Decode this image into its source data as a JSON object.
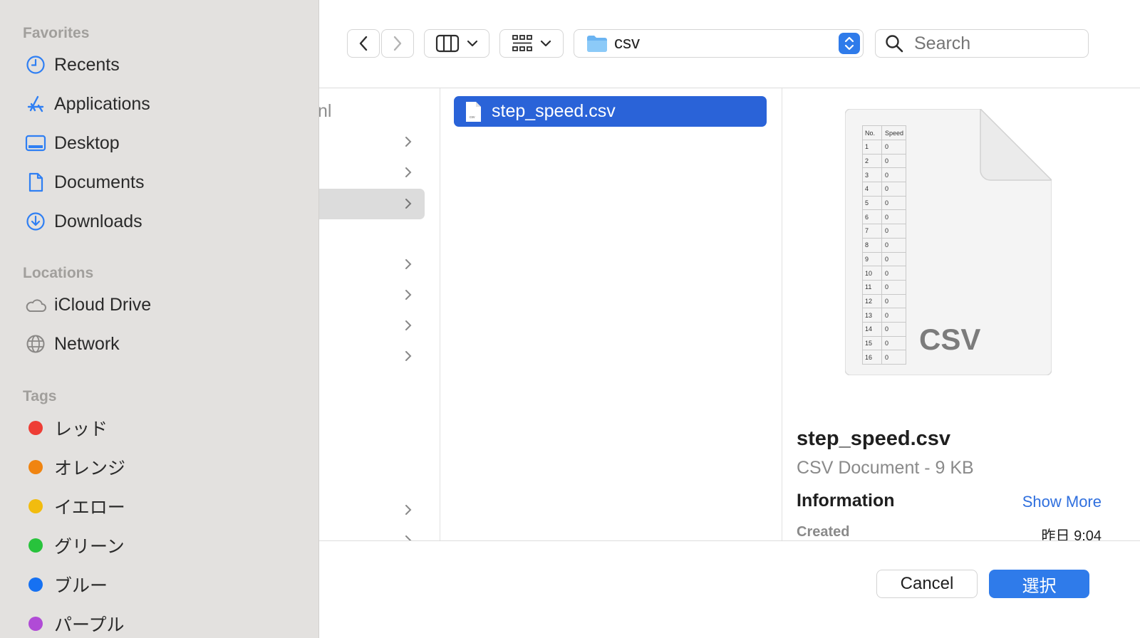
{
  "sidebar": {
    "favorites_title": "Favorites",
    "favorites": [
      {
        "label": "Recents",
        "icon": "clock-icon"
      },
      {
        "label": "Applications",
        "icon": "applications-icon"
      },
      {
        "label": "Desktop",
        "icon": "desktop-icon"
      },
      {
        "label": "Documents",
        "icon": "document-icon"
      },
      {
        "label": "Downloads",
        "icon": "download-icon"
      }
    ],
    "locations_title": "Locations",
    "locations": [
      {
        "label": "iCloud Drive",
        "icon": "cloud-icon"
      },
      {
        "label": "Network",
        "icon": "globe-icon"
      }
    ],
    "tags_title": "Tags",
    "tags": [
      {
        "label": "レッド",
        "color": "#ee3d35"
      },
      {
        "label": "オレンジ",
        "color": "#f08410"
      },
      {
        "label": "イエロー",
        "color": "#f2bc0e"
      },
      {
        "label": "グリーン",
        "color": "#28c33c"
      },
      {
        "label": "ブルー",
        "color": "#1671f2"
      },
      {
        "label": "パープル",
        "color": "#b04bd6"
      }
    ]
  },
  "toolbar": {
    "path_label": "csv",
    "search_placeholder": "Search"
  },
  "browser": {
    "partial_item_text": "nl",
    "selected_file": "step_speed.csv"
  },
  "preview": {
    "badge": "CSV",
    "thumb_headers": [
      "No.",
      "Speed"
    ],
    "thumb_rows": [
      [
        "1",
        "0"
      ],
      [
        "2",
        "0"
      ],
      [
        "3",
        "0"
      ],
      [
        "4",
        "0"
      ],
      [
        "5",
        "0"
      ],
      [
        "6",
        "0"
      ],
      [
        "7",
        "0"
      ],
      [
        "8",
        "0"
      ],
      [
        "9",
        "0"
      ],
      [
        "10",
        "0"
      ],
      [
        "11",
        "0"
      ],
      [
        "12",
        "0"
      ],
      [
        "13",
        "0"
      ],
      [
        "14",
        "0"
      ],
      [
        "15",
        "0"
      ],
      [
        "16",
        "0"
      ]
    ],
    "file_name": "step_speed.csv",
    "file_kind": "CSV Document - 9 KB",
    "info_title": "Information",
    "show_more": "Show More",
    "created_label": "Created",
    "created_value": "昨日 9:04"
  },
  "buttons": {
    "cancel": "Cancel",
    "select": "選択"
  },
  "colors": {
    "accent": "#2f6fde",
    "selection": "#2a63d8",
    "sidebar_bg": "#e3e1df"
  }
}
